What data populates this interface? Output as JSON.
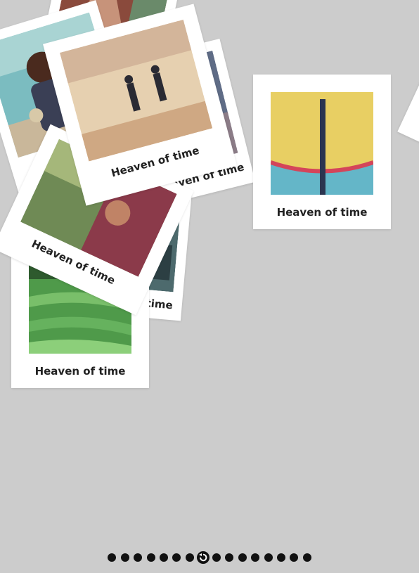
{
  "gallery": {
    "caption": "Heaven of time",
    "photos": [
      {
        "subject": "temple"
      },
      {
        "subject": "boy-at-beach"
      },
      {
        "subject": "dusk-surfboards"
      },
      {
        "subject": "bright-window"
      },
      {
        "subject": "woman-sarong"
      },
      {
        "subject": "beach-walkers"
      },
      {
        "subject": "rice-terraces"
      },
      {
        "subject": "yellow-umbrella"
      },
      {
        "subject": "edge-photo"
      }
    ]
  },
  "navigation": {
    "dots_before_reset": 7,
    "dots_after_reset": 8,
    "reset_icon": "undo-icon"
  },
  "colors": {
    "background": "#cccccc",
    "card": "#ffffff",
    "caption": "#222222",
    "dot": "#111111"
  }
}
